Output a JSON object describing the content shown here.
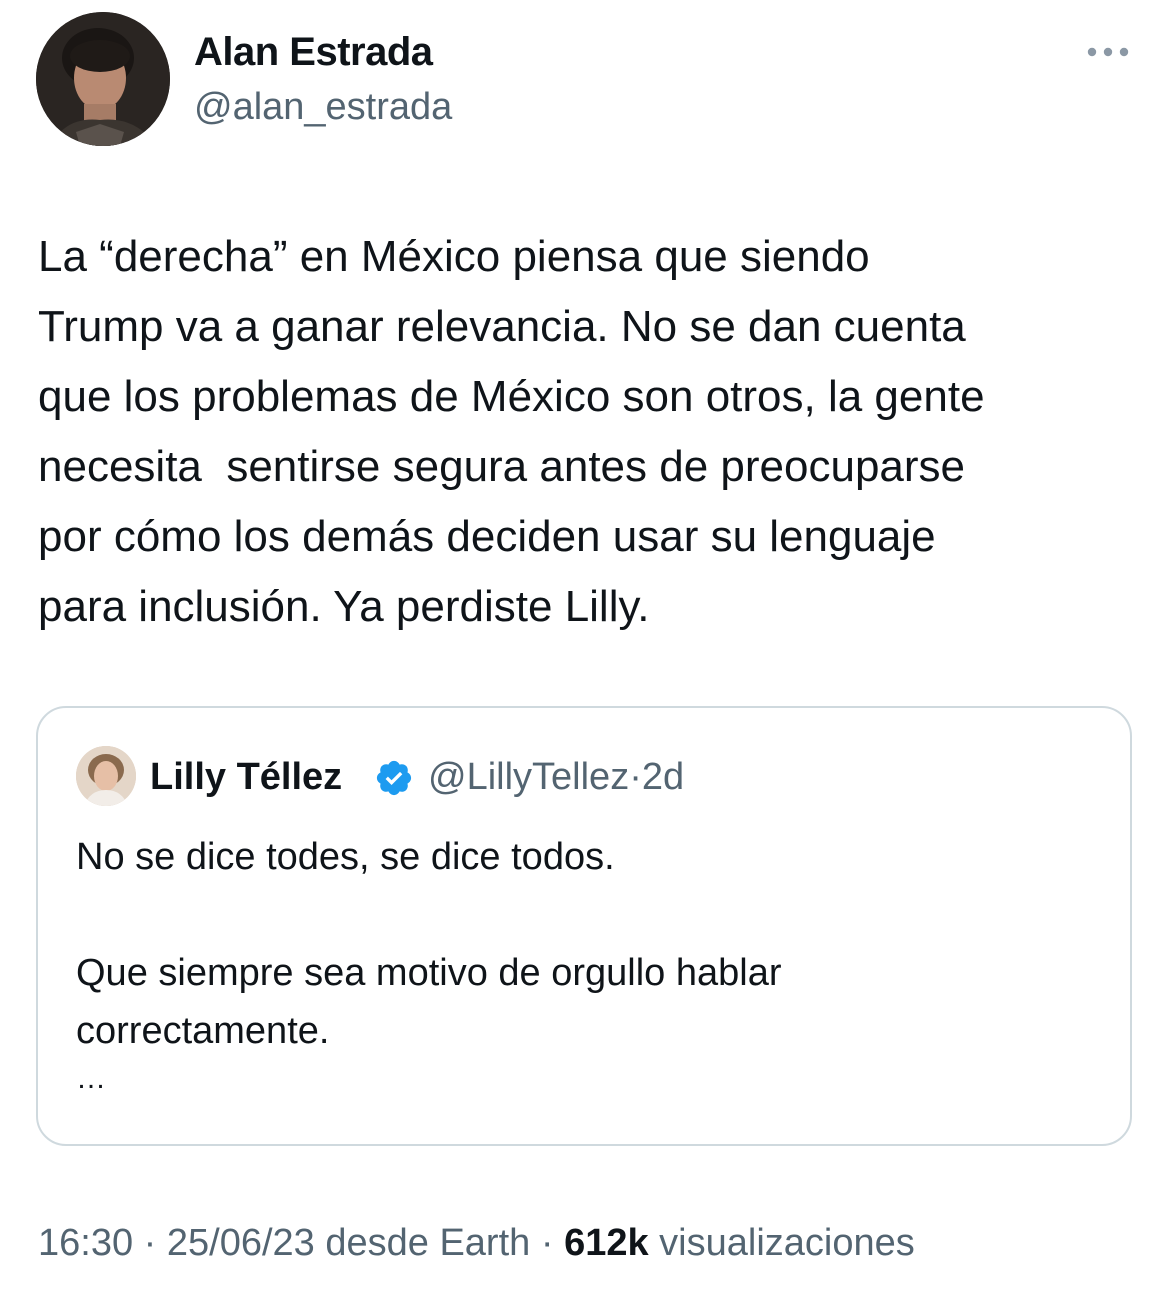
{
  "tweet": {
    "author": {
      "name": "Alan Estrada",
      "handle": "@alan_estrada"
    },
    "text": "La “derecha” en México piensa que siendo\nTrump va a ganar relevancia. No se dan cuenta\nque los problemas de México son otros, la gente\nnecesita  sentirse segura antes de preocuparse\npor cómo los demás deciden usar su lenguaje\npara inclusión. Ya perdiste Lilly.",
    "more_icon": "more-horizontal-icon",
    "footer": {
      "time": "16:30",
      "sep1": " · ",
      "date": "25/06/23",
      "source": " desde Earth",
      "sep2": " · ",
      "views_count": "612k",
      "views_label": " visualizaciones"
    }
  },
  "quote": {
    "author": {
      "name": "Lilly Téllez",
      "verified": true,
      "handle": "@LillyTellez",
      "separator": "·",
      "age": "2d"
    },
    "text": "No se dice todes, se dice todos.\n\nQue siempre sea motivo de orgullo hablar\ncorrectamente.",
    "ellipsis": "…"
  },
  "colors": {
    "text_primary": "#0f1419",
    "text_secondary": "#536471",
    "border": "#cfd9de",
    "verified_blue": "#1d9bf0"
  }
}
